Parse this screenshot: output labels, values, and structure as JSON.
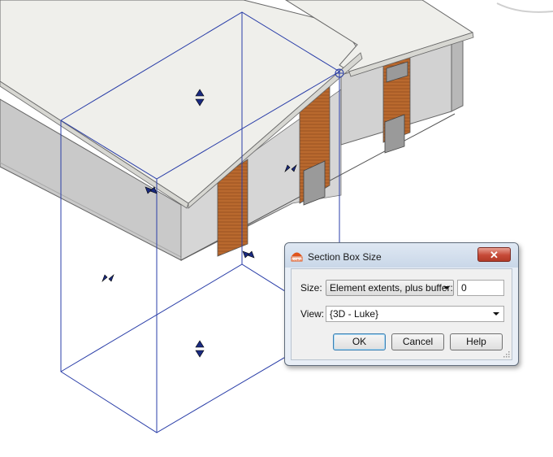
{
  "dialog": {
    "title": "Section Box Size",
    "close_label": "✕",
    "size_label": "Size:",
    "size_mode": "Element extents, plus buffer:",
    "buffer_value": "0",
    "view_label": "View:",
    "view_value": "{3D - Luke}",
    "ok_label": "OK",
    "cancel_label": "Cancel",
    "help_label": "Help"
  },
  "icons": {
    "app": "app-icon",
    "close": "close-icon",
    "dropdown": "chevron-down-icon",
    "grip": "resize-grip-icon",
    "grip_handle": "section-box-grip-icon"
  },
  "colors": {
    "section_box": "#2233aa",
    "roof": "#eeeeea",
    "wall": "#cfcfcf",
    "door_wood": "#b8672d",
    "close_button": "#c64a37"
  }
}
